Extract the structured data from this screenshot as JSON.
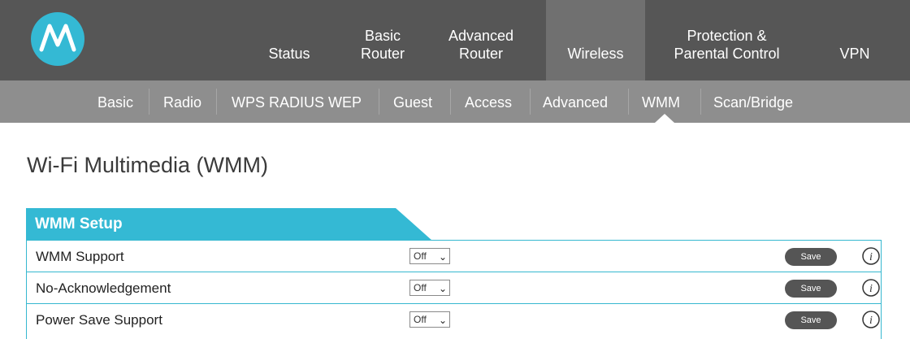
{
  "colors": {
    "nav_bg": "#565656",
    "nav_active": "#707070",
    "subnav_bg": "#8e8e8e",
    "accent": "#34b9d4",
    "button": "#555555"
  },
  "logo": {
    "icon": "motorola-logo"
  },
  "topnav": {
    "items": [
      {
        "lines": [
          "Status"
        ]
      },
      {
        "lines": [
          "Basic",
          "Router"
        ]
      },
      {
        "lines": [
          "Advanced",
          "Router"
        ]
      },
      {
        "lines": [
          "Wireless"
        ],
        "active": true
      },
      {
        "lines": [
          "Protection &",
          "Parental Control"
        ]
      },
      {
        "lines": [
          "VPN"
        ]
      }
    ]
  },
  "subnav": {
    "items": [
      "Basic",
      "Radio",
      "WPS RADIUS WEP",
      "Guest",
      "Access",
      "Advanced",
      "WMM",
      "Scan/Bridge"
    ],
    "active": "WMM"
  },
  "page": {
    "title": "Wi-Fi Multimedia (WMM)"
  },
  "panel": {
    "title": "WMM Setup",
    "rows": [
      {
        "label": "WMM Support",
        "value": "Off",
        "save": "Save",
        "info_icon": "info-icon"
      },
      {
        "label": "No-Acknowledgement",
        "value": "Off",
        "save": "Save",
        "info_icon": "info-icon"
      },
      {
        "label": "Power Save Support",
        "value": "Off",
        "save": "Save",
        "info_icon": "info-icon"
      }
    ]
  }
}
